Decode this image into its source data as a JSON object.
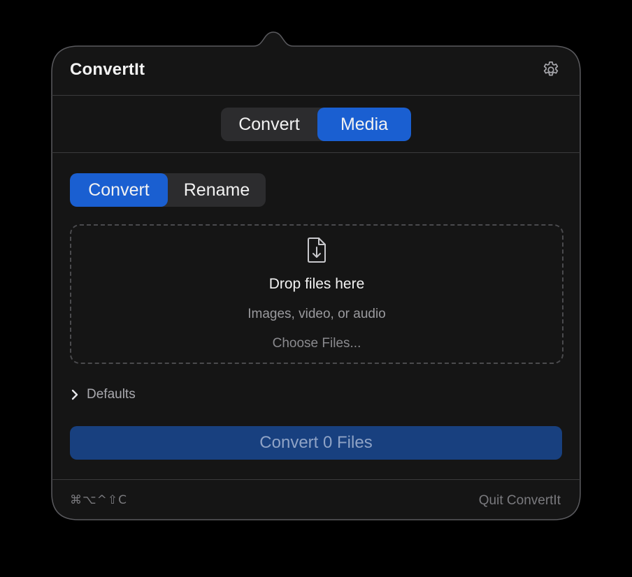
{
  "app": {
    "title": "ConvertIt"
  },
  "header": {
    "settings_icon": "gear-icon"
  },
  "top_tabs": [
    {
      "label": "Convert",
      "selected": false
    },
    {
      "label": "Media",
      "selected": true
    }
  ],
  "mode_tabs": [
    {
      "label": "Convert",
      "selected": true
    },
    {
      "label": "Rename",
      "selected": false
    }
  ],
  "dropzone": {
    "icon": "file-download-icon",
    "title": "Drop files here",
    "subtitle": "Images, video, or audio",
    "choose_label": "Choose Files..."
  },
  "defaults": {
    "label": "Defaults",
    "icon": "chevron-right-icon",
    "expanded": false
  },
  "primary_button": {
    "label": "Convert 0 Files",
    "enabled": false
  },
  "footer": {
    "shortcut": "⌘⌥^⇧C",
    "quit_label": "Quit ConvertIt"
  },
  "colors": {
    "background": "#000000",
    "panel": "#141414",
    "accent": "#1a5fd1",
    "disabled_button": "#18407f"
  }
}
